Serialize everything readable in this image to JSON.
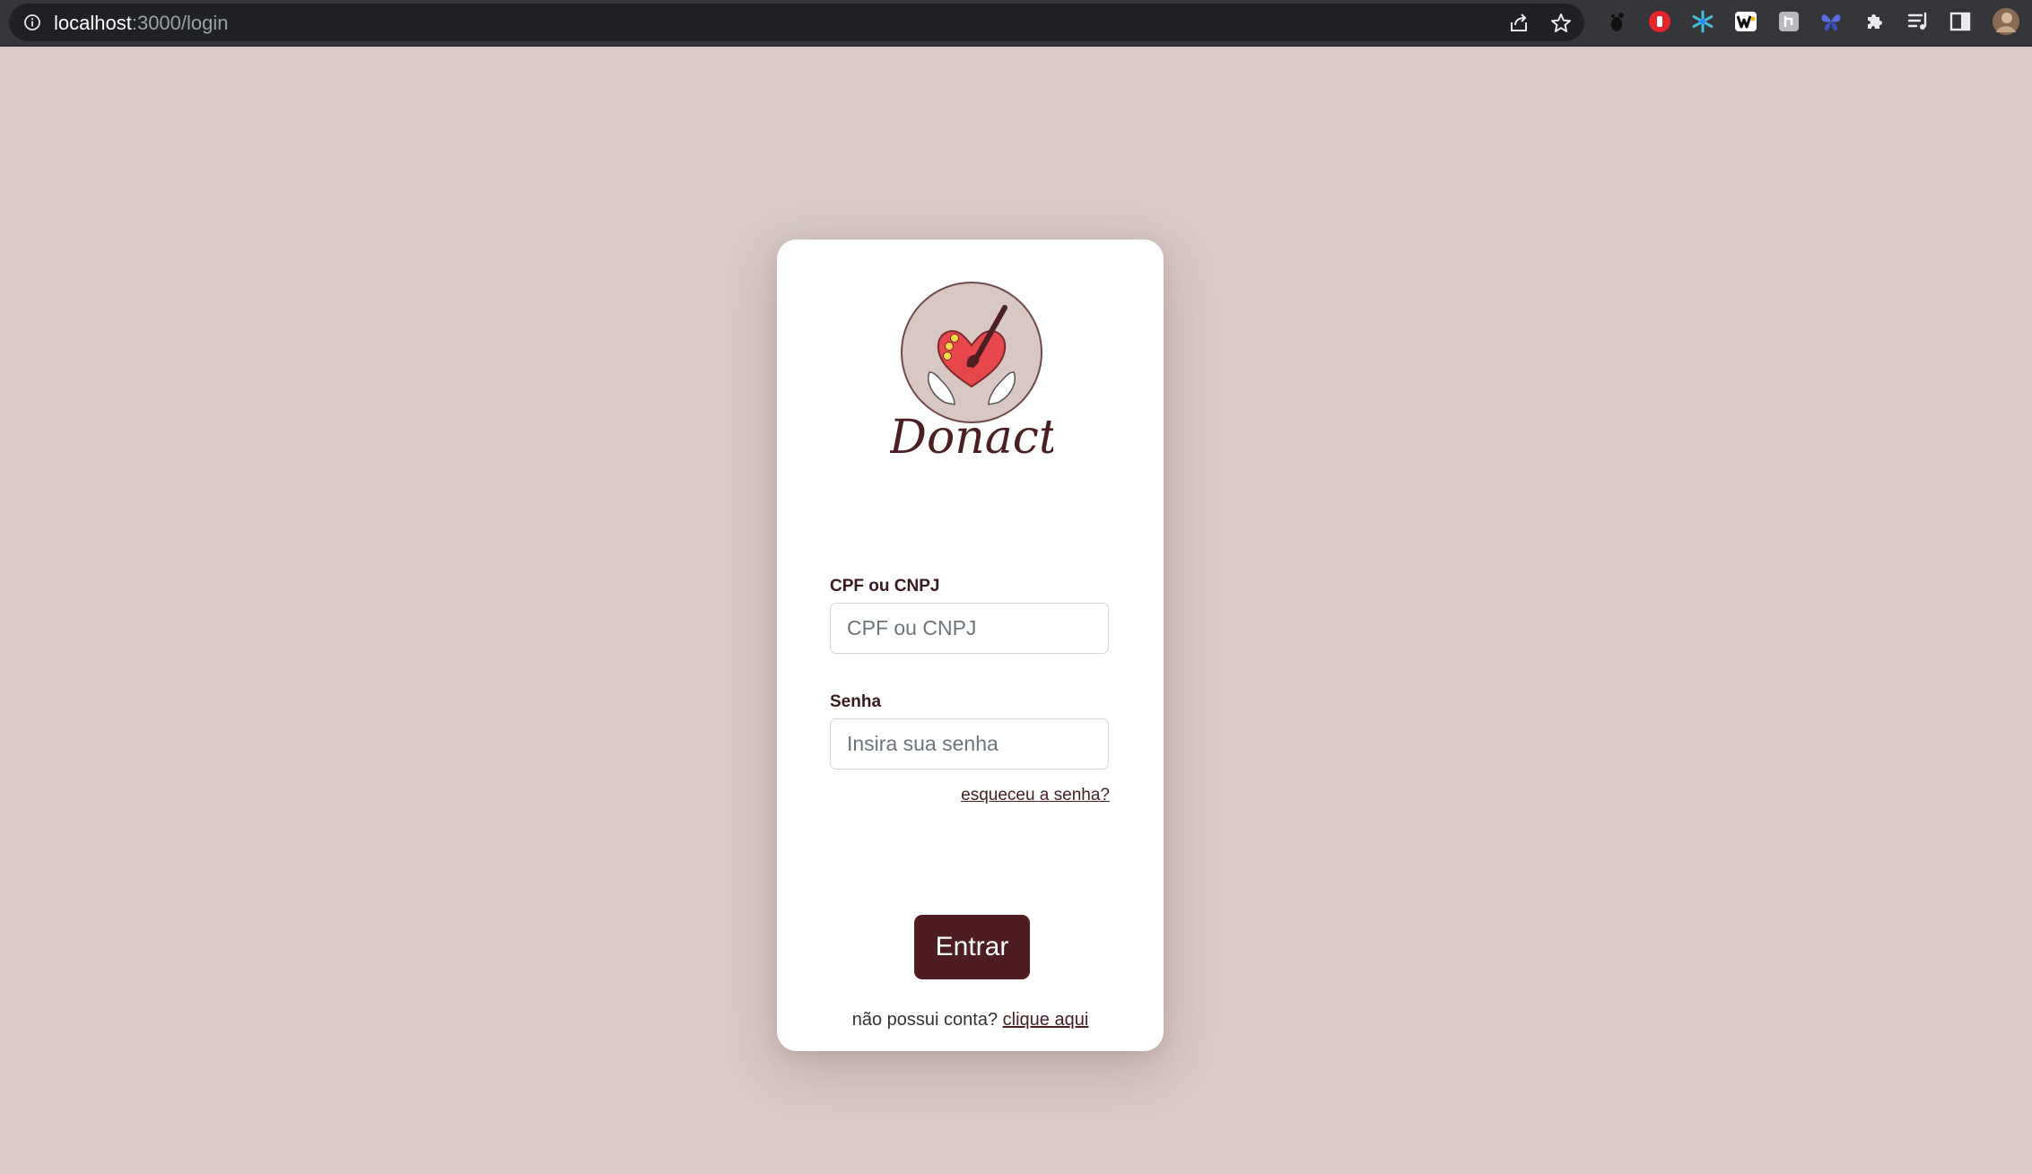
{
  "browser": {
    "url_host": "localhost",
    "url_path": ":3000/login",
    "icons": [
      "info-icon",
      "share-icon",
      "bookmark-star-icon",
      "extension-icons",
      "puzzle-icon",
      "reading-list-icon",
      "side-panel-icon",
      "profile-avatar"
    ]
  },
  "login": {
    "logo_text": "Donact",
    "cpf_label": "CPF ou CNPJ",
    "cpf_placeholder": "CPF ou CNPJ",
    "cpf_value": "",
    "password_label": "Senha",
    "password_placeholder": "Insira sua senha",
    "password_value": "",
    "forgot_link": "esqueceu a senha?",
    "submit_label": "Entrar",
    "signup_prompt": "não possui conta?",
    "signup_link": "clique aqui"
  },
  "colors": {
    "page_background": "#d9cac7",
    "card_background": "#ffffff",
    "primary": "#4e1d22",
    "label_text": "#3a1a1c"
  }
}
